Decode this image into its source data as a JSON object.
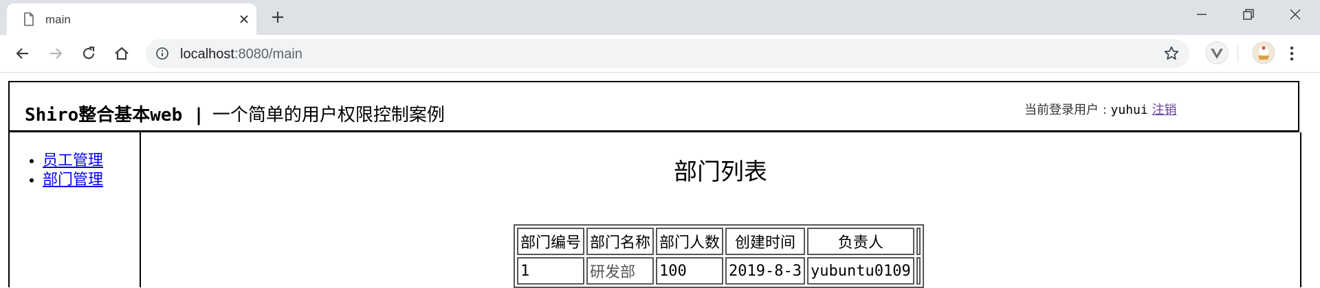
{
  "browser": {
    "tab_title": "main",
    "url_host": "localhost",
    "url_path": ":8080/main"
  },
  "header": {
    "title_prefix": "Shiro整合基本web",
    "title_separator": "|",
    "title_subtitle": "一个简单的用户权限控制案例",
    "user_label": "当前登录用户 :",
    "username": "yuhui",
    "logout_label": "注销"
  },
  "sidebar": {
    "items": [
      {
        "label": "员工管理"
      },
      {
        "label": "部门管理"
      }
    ]
  },
  "main": {
    "heading": "部门列表",
    "table": {
      "columns": [
        "部门编号",
        "部门名称",
        "部门人数",
        "创建时间",
        "负责人"
      ],
      "rows": [
        [
          "1",
          "研发部",
          "100",
          "2019-8-3",
          "yubuntu0109"
        ]
      ]
    }
  }
}
